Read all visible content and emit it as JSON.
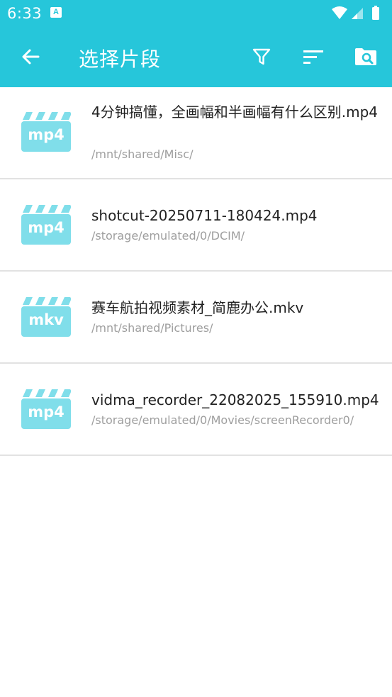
{
  "status_bar": {
    "time": "6:33",
    "notification_glyph": "A",
    "icons": [
      "wifi-icon",
      "cell-signal-icon",
      "battery-icon"
    ]
  },
  "app_bar": {
    "title": "选择片段",
    "actions": [
      "back-arrow-icon",
      "filter-icon",
      "sort-icon",
      "folder-search-icon"
    ]
  },
  "colors": {
    "primary": "#26c6da",
    "thumb": "#80deea",
    "text": "#222222",
    "subtext": "#9e9e9e",
    "divider": "#e2e2e2"
  },
  "files": [
    {
      "ext": "mp4",
      "name": "4分钟搞懂，全画幅和半画幅有什么区别.mp4",
      "path": "/mnt/shared/Misc/"
    },
    {
      "ext": "mp4",
      "name": "shotcut-20250711-180424.mp4",
      "path": "/storage/emulated/0/DCIM/"
    },
    {
      "ext": "mkv",
      "name": "赛车航拍视频素材_简鹿办公.mkv",
      "path": "/mnt/shared/Pictures/"
    },
    {
      "ext": "mp4",
      "name": "vidma_recorder_22082025_155910.mp4",
      "path": "/storage/emulated/0/Movies/screenRecorder0/"
    }
  ]
}
